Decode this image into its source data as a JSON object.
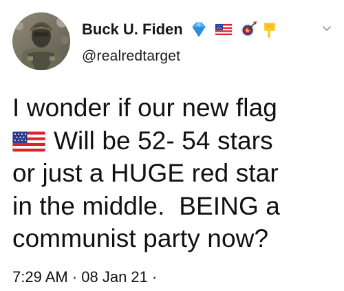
{
  "tweet": {
    "author": {
      "display_name": "Buck U. Fiden",
      "handle": "@realredtarget",
      "avatar_icon": "soldier-avatar",
      "name_emojis": [
        "gem-icon",
        "us-flag-icon",
        "target-icon",
        "pointing-down-hand-icon"
      ]
    },
    "menu_icon": "chevron-down-icon",
    "text_lines": [
      "I wonder if our new flag",
      "Will be 52- 54 stars",
      "or just a HUGE red star",
      "in the middle.  BEING a",
      "communist party now?"
    ],
    "inline_emoji": "us-flag-icon",
    "meta": "7:29 AM · 08 Jan 21 ·"
  },
  "colors": {
    "text": "#14171a",
    "chevron": "#8899a6",
    "gem": "#4fb3ff",
    "flag_red": "#d8232a",
    "flag_blue": "#2b3a8c"
  }
}
